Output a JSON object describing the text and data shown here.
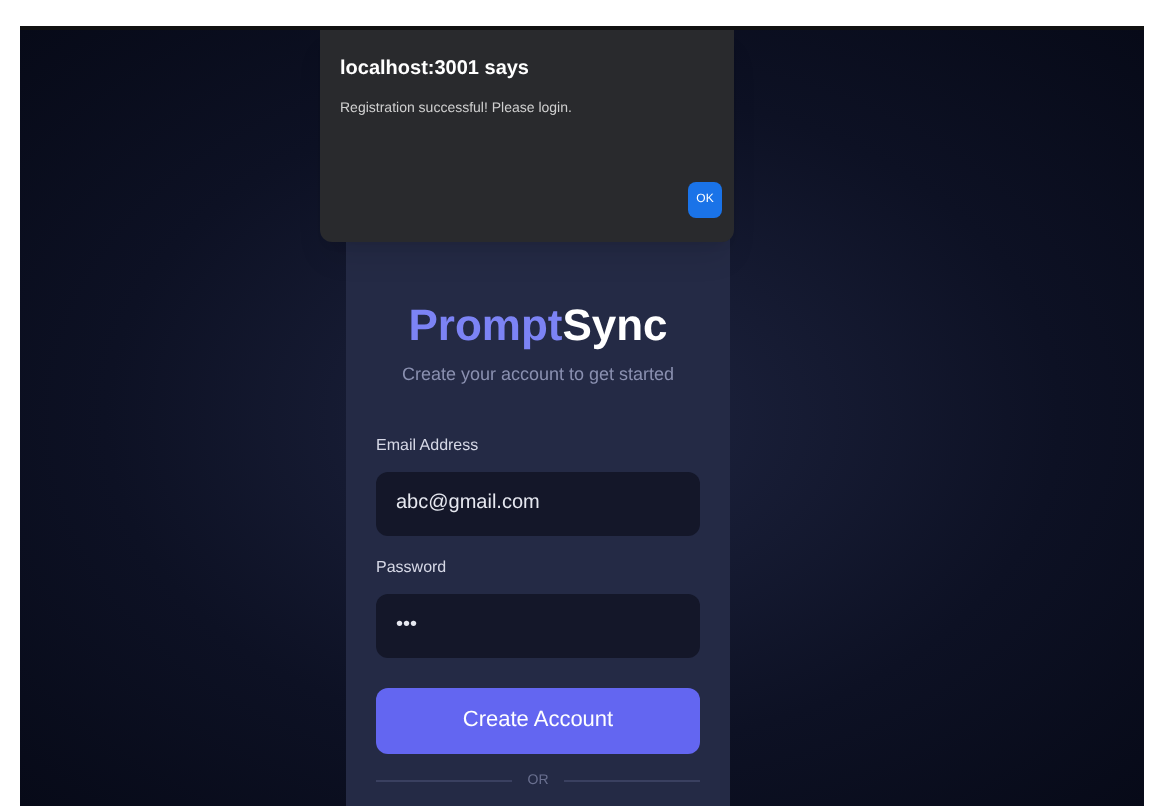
{
  "dialog": {
    "title": "localhost:3001 says",
    "message": "Registration successful! Please login.",
    "button": "OK"
  },
  "card": {
    "brand": {
      "part_1": "Prompt",
      "part_2": "Sync"
    },
    "subtitle": "Create your account to get started",
    "fields": [
      {
        "label": "Email Address",
        "value": "abc@gmail.com"
      },
      {
        "label": "Password",
        "value": "•••"
      }
    ],
    "submit": "Create Account",
    "divider": "OR"
  }
}
